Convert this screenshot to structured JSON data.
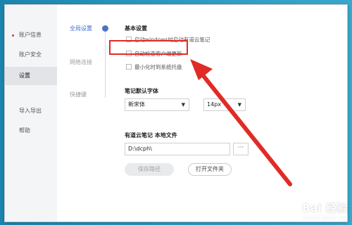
{
  "sidebar": {
    "items": [
      {
        "label": "账户信息",
        "active": false,
        "dot": true
      },
      {
        "label": "账户安全",
        "active": false,
        "dot": false
      },
      {
        "label": "设置",
        "active": true,
        "dot": false
      },
      {
        "label": "导入导出",
        "active": false,
        "dot": false
      },
      {
        "label": "帮助",
        "active": false,
        "dot": false
      }
    ]
  },
  "subnav": {
    "items": [
      {
        "label": "全局设置",
        "active": true
      },
      {
        "label": "网络连接",
        "active": false
      },
      {
        "label": "快捷键",
        "active": false
      }
    ]
  },
  "basic": {
    "title": "基本设置",
    "options": [
      {
        "label": "启动windows时启动有道云笔记",
        "checked": false
      },
      {
        "label": "自动检查客户端更新",
        "checked": false
      },
      {
        "label": "最小化时到系统托盘",
        "checked": false
      }
    ]
  },
  "font": {
    "title": "笔记默认字体",
    "family_value": "新宋体",
    "size_value": "14px"
  },
  "storage": {
    "title": "有道云笔记  本地文件",
    "path_value": "D:\\dcph\\",
    "browse_label": "···",
    "save_label": "保存路径",
    "open_label": "打开文件夹"
  },
  "watermark": {
    "logo": "Bai 经验",
    "sub": "jingyan.baidu.com"
  },
  "colors": {
    "highlight": "#e02b26",
    "accent": "#4a75c4",
    "background": "#1f8fb8"
  }
}
